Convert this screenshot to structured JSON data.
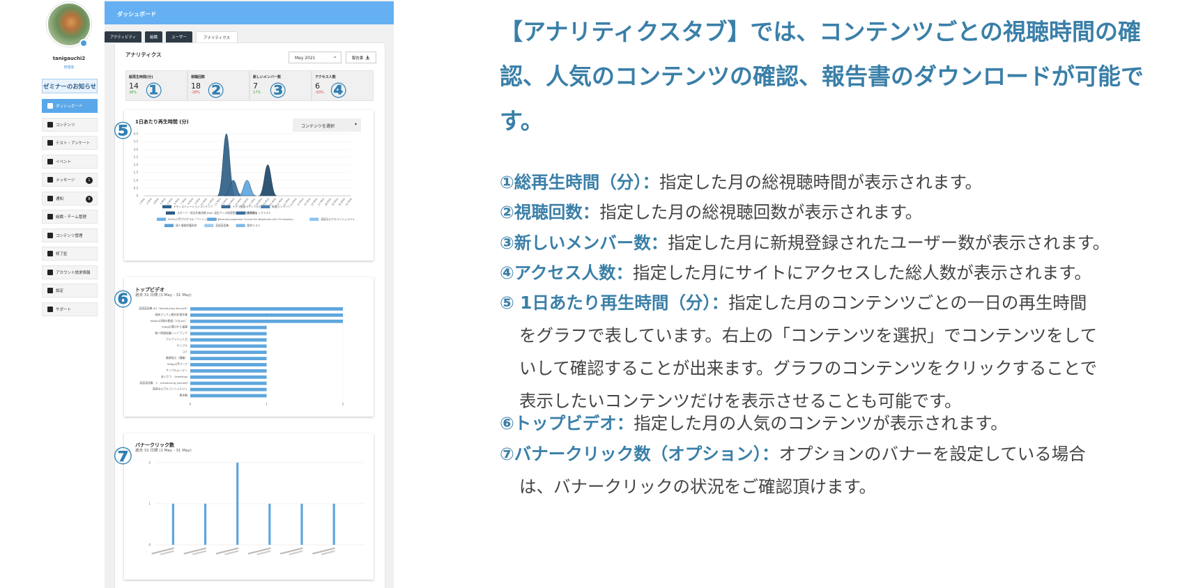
{
  "sidebar": {
    "username": "tanigauchi2",
    "role": "管理者",
    "seminar_banner": "ゼミナーのお知らせ",
    "items": [
      {
        "label": "ダッシュボード",
        "icon": "dashboard-icon",
        "active": true
      },
      {
        "label": "コンテンツ",
        "icon": "book-icon"
      },
      {
        "label": "テスト・アンケート",
        "icon": "clipboard-icon"
      },
      {
        "label": "イベント",
        "icon": "megaphone-icon"
      },
      {
        "label": "メッセージ",
        "icon": "chat-icon",
        "badge": "1"
      },
      {
        "label": "通知",
        "icon": "bell-icon",
        "badge": "8"
      },
      {
        "label": "組織・チーム管理",
        "icon": "team-icon"
      },
      {
        "label": "コンテンツ管理",
        "icon": "folder-icon"
      },
      {
        "label": "修了証",
        "icon": "certificate-icon"
      },
      {
        "label": "アカウント請求情報",
        "icon": "account-icon"
      },
      {
        "label": "設定",
        "icon": "gear-icon"
      },
      {
        "label": "サポート",
        "icon": "info-icon"
      }
    ]
  },
  "dashboard": {
    "header": "ダッシュボード",
    "tabs": [
      "アクティビティ",
      "組織",
      "ユーザー",
      "アナリティクス"
    ],
    "selected_tab": "アナリティクス",
    "section_title": "アナリティクス",
    "month": "May 2021",
    "report_button": "報告書",
    "stats": [
      {
        "label": "総再生時間(分)",
        "value": "14",
        "change": "28%",
        "dir": "up",
        "marker": "①"
      },
      {
        "label": "視聴回数",
        "value": "18",
        "change": "-28%",
        "dir": "down",
        "marker": "②"
      },
      {
        "label": "新しいメンバー数",
        "value": "7",
        "change": "17%",
        "dir": "up",
        "marker": "③"
      },
      {
        "label": "アクセス人数",
        "value": "6",
        "change": "-93%",
        "dir": "down",
        "marker": "④"
      }
    ],
    "daily_chart": {
      "marker": "⑤",
      "title": "1日あたり再生時間 (分)",
      "select_label": "コンテンツを選択",
      "legend": [
        "デモンストレーションコンテンツ",
        "イデラ動画 Eサンプルビデオ",
        "新着コンテンツ",
        "スポーツ・保全作業改善 JDAC 認定アンス指導税定研·ご総連の講座",
        "視聴チェックテスト",
        "DOGs入門プログラム「ベーシックコース」",
        "Business Japanese Course for Beginners (All 15 Lessons)",
        "英語なんでもコンシェルジュ",
        "個人情報保護研修",
        "英語英語集",
        "動作テスト"
      ]
    },
    "top_video": {
      "marker": "⑥",
      "title": "トップビデオ",
      "subtitle": "過去 31 日間 (1 May - 31 May)"
    },
    "banner_click": {
      "marker": "⑦",
      "title": "バナークリック数",
      "subtitle": "過去 31 日間 (1 May - 31 May)"
    }
  },
  "chart_data": [
    {
      "type": "area",
      "title": "1日あたり再生時間 (分)",
      "ylim": [
        0,
        4.0
      ],
      "yticks": [
        "0",
        "0.5",
        "1.0",
        "1.5",
        "2.0",
        "2.5",
        "3.0",
        "3.5",
        "4.0"
      ],
      "x": [
        "1 May",
        "2 May",
        "3 May",
        "4 May",
        "5 May",
        "6 May",
        "7 May",
        "8 May",
        "9 May",
        "10 May",
        "11 May",
        "12 May",
        "13 May",
        "14 May",
        "15 May",
        "16 May",
        "17 May",
        "18 May",
        "19 May",
        "20 May",
        "21 May",
        "22 May",
        "23 May",
        "24 May",
        "25 May",
        "26 May",
        "27 May",
        "28 May",
        "29 May",
        "30 May",
        "31 May"
      ],
      "series": [
        {
          "name": "デモンストレーションコンテンツ",
          "color": "#2f5f86",
          "values": [
            0,
            0,
            0,
            0,
            0,
            0,
            0,
            0,
            0,
            0,
            0,
            0,
            4.0,
            0,
            0,
            0,
            0,
            0,
            0,
            0,
            0,
            0,
            0,
            0,
            0,
            0,
            0,
            0,
            0,
            0,
            0
          ]
        },
        {
          "name": "イデラ動画 Eサンプルビデオ",
          "color": "#3c6d96",
          "values": [
            0,
            0,
            0,
            0,
            0,
            0,
            0,
            0,
            0,
            0,
            0,
            0,
            0,
            1.0,
            0,
            0,
            0,
            0,
            0,
            0,
            0,
            0,
            0,
            0,
            0,
            0,
            0,
            0,
            0,
            0,
            0
          ]
        },
        {
          "name": "新着コンテンツ",
          "color": "#5ea6dd",
          "values": [
            0,
            0,
            0,
            0,
            0,
            0,
            0,
            0,
            0,
            0,
            0,
            0,
            0,
            0,
            0,
            1.0,
            0,
            0,
            0,
            0,
            0,
            0,
            0,
            0,
            0,
            0,
            0,
            0,
            0,
            0,
            0
          ]
        },
        {
          "name": "視聴チェックテスト",
          "color": "#1f4868",
          "values": [
            0,
            0,
            0,
            0,
            0,
            0,
            0,
            0,
            0,
            0,
            0,
            0,
            0,
            0,
            0,
            0,
            0,
            0,
            2.0,
            0,
            0,
            0,
            0,
            0,
            0,
            0,
            0,
            0,
            0,
            0,
            0
          ]
        }
      ]
    },
    {
      "type": "bar",
      "orientation": "horizontal",
      "title": "トップビデオ",
      "xlim": [
        0,
        2
      ],
      "xticks": [
        "0",
        "1",
        "2"
      ],
      "categories": [
        "英語英語集 #1 \"Introducing Yourself\"",
        "焼肉ブッフェ観光料理作業",
        "Motion印刷の動画（1分ver）",
        "500gの運びかた基礎",
        "個人情報保護ハンドブック",
        "アルファベット方",
        "サンプル",
        "コテ",
        "業務指示（講義）",
        "500g入門ワーク",
        "サンプルムービー",
        "あいさつ　Greetings",
        "英語英語集　1　Introducing yourself",
        "英語なんでもコンシェルジュ",
        "基本編"
      ],
      "values": [
        2,
        2,
        2,
        1,
        1,
        1,
        1,
        1,
        1,
        1,
        1,
        1,
        1,
        1,
        1
      ]
    },
    {
      "type": "bar",
      "title": "バナークリック数",
      "ylim": [
        0,
        2
      ],
      "yticks": [
        "0",
        "1",
        "2"
      ],
      "values": [
        1,
        1,
        2,
        1,
        1,
        1
      ]
    }
  ],
  "description": {
    "headline": "【アナリティクスタブ】では、コンテンツごとの視聴時間の確認、人気のコンテンツの確認、報告書のダウンロードが可能です。",
    "items": [
      {
        "term": "①総再生時間（分）：",
        "text": "指定した月の総視聴時間が表示されます。"
      },
      {
        "term": "②視聴回数：",
        "text": "指定した月の総視聴回数が表示されます。"
      },
      {
        "term": "③新しいメンバー数：",
        "text": "指定した月に新規登録されたユーザー数が表示されます。"
      },
      {
        "term": "④アクセス人数：",
        "text": "指定した月にサイトにアクセスした総人数が表示されます。"
      },
      {
        "term": "⑤ 1日あたり再生時間（分）：",
        "text": "指定した月のコンテンツごとの一日の再生時間",
        "cont": [
          "をグラフで表しています。右上の「コンテンツを選択」でコンテンツをして",
          "いして確認することが出来ます。グラフのコンテンツをクリックすることで",
          "表示したいコンテンツだけを表示させることも可能です。"
        ]
      },
      {
        "term": "⑥トップビデオ：",
        "text": "指定した月の人気のコンテンツが表示されます。"
      },
      {
        "term": "⑦バナークリック数（オプション）：",
        "text": "オプションのバナーを設定している場合",
        "cont": [
          "は、バナークリックの状況をご確認頂けます。"
        ]
      }
    ]
  }
}
